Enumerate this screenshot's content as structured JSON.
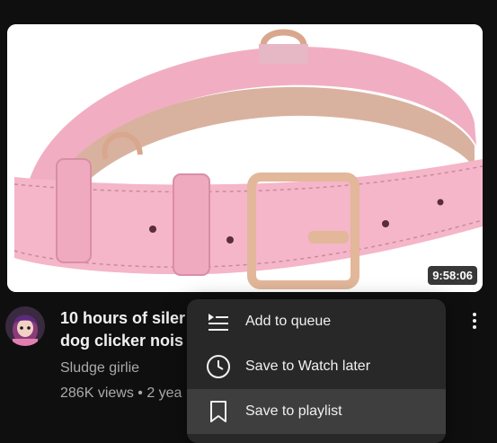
{
  "video": {
    "duration": "9:58:06",
    "title_line1": "10 hours of siler",
    "title_line2": "dog clicker nois",
    "channel": "Sludge girlie",
    "meta": "286K views • 2 yea"
  },
  "menu": {
    "items": [
      {
        "label": "Add to queue",
        "icon": "add-to-queue-icon"
      },
      {
        "label": "Save to Watch later",
        "icon": "clock-icon"
      },
      {
        "label": "Save to playlist",
        "icon": "bookmark-icon"
      }
    ]
  },
  "colors": {
    "background": "#0f0f0f",
    "menu_bg": "#282828",
    "menu_hover": "#3e3e3e",
    "collar_pink": "#f4b6c8",
    "buckle_gold": "#e2b79a"
  }
}
